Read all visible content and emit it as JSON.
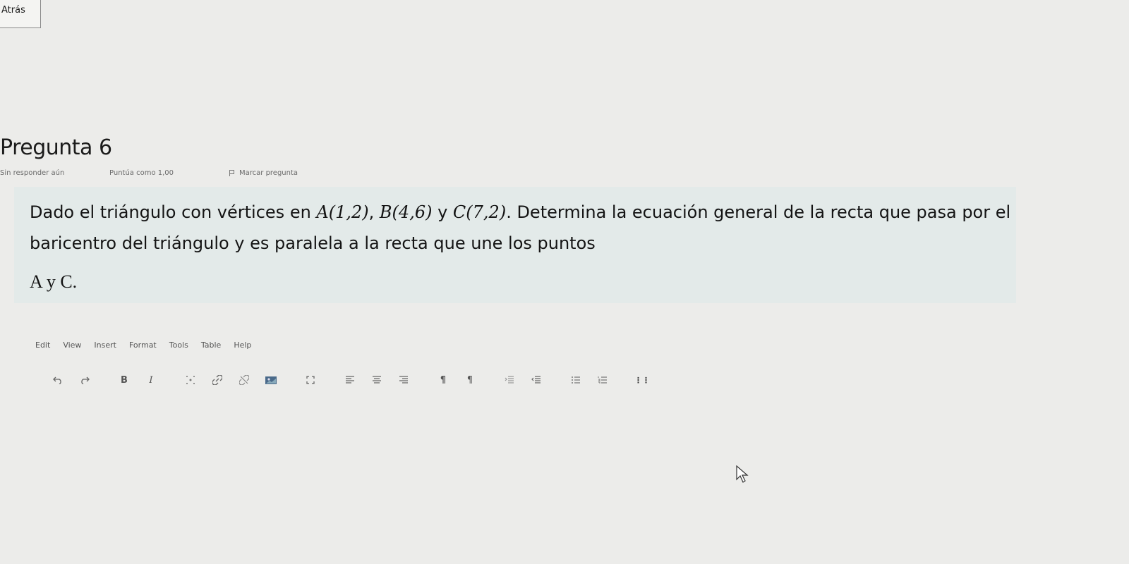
{
  "nav": {
    "back_label": "Atrás"
  },
  "question": {
    "title": "Pregunta 6",
    "status": "Sin responder aún",
    "grade": "Puntúa como 1,00",
    "flag_label": "Marcar pregunta",
    "text_part1": "Dado el triángulo con vértices en ",
    "point_a": "A(1,2)",
    "sep1": ", ",
    "point_b": "B(4,6)",
    "connector": " y ",
    "point_c": "C(7,2)",
    "text_part2": ". Determina la ecuación general de la recta que pasa por el baricentro del triángulo y es paralela a la recta que une los puntos",
    "text_end": "A y C."
  },
  "editor": {
    "menu": [
      "Edit",
      "View",
      "Insert",
      "Format",
      "Tools",
      "Table",
      "Help"
    ],
    "toolbar_labels": {
      "bold": "B",
      "italic": "I",
      "ltr": "¶",
      "rtl": "¶",
      "grid": "⋮⋮"
    },
    "toolbar_icons": [
      "undo-icon",
      "redo-icon",
      "bold-icon",
      "italic-icon",
      "special-char-icon",
      "link-icon",
      "unlink-icon",
      "image-icon",
      "fullscreen-icon",
      "align-left-icon",
      "align-center-icon",
      "align-right-icon",
      "ltr-icon",
      "rtl-icon",
      "indent-icon",
      "outdent-icon",
      "bullet-list-icon",
      "number-list-icon",
      "table-icon"
    ]
  }
}
